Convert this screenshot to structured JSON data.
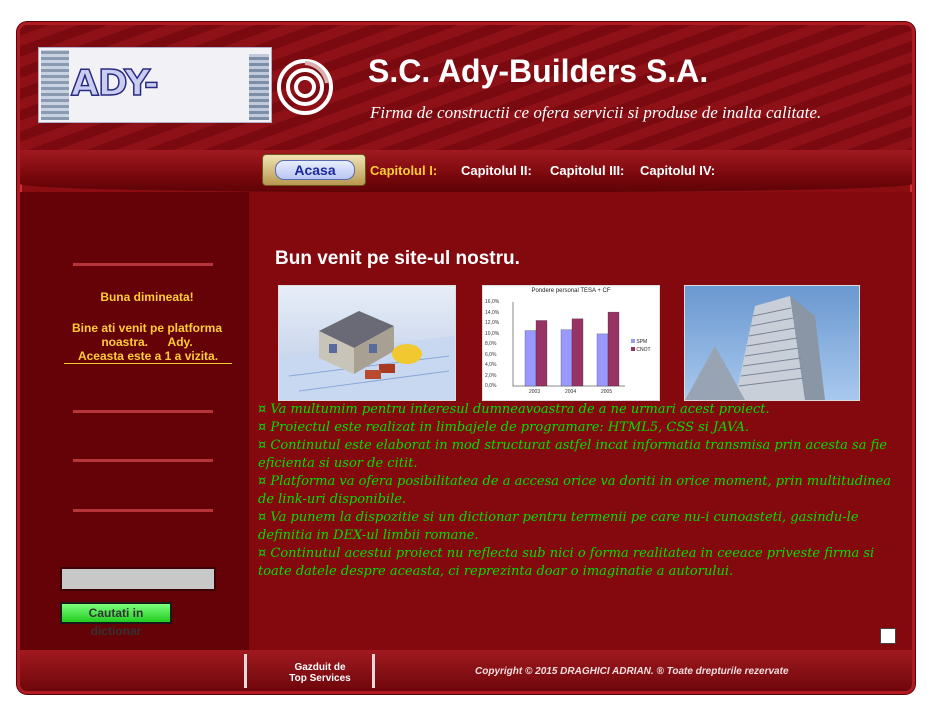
{
  "header": {
    "logo_text": "ADY-BUILDERS",
    "title": "S.C. Ady-Builders S.A.",
    "subtitle": "Firma de constructii ce ofera servicii si produse de inalta calitate."
  },
  "nav": {
    "home_label": "Acasa",
    "items": [
      "Capitolul I:",
      "Capitolul II:",
      "Capitolul III:",
      "Capitolul IV:"
    ]
  },
  "sidebar": {
    "greeting": "Buna dimineata!",
    "welcome_line1": "Bine ati venit pe platforma",
    "welcome_line2": "noastra.      Ady.",
    "visits": "Aceasta este a 1 a vizita.",
    "search_value": "",
    "search_button": "Cautati in dictionar"
  },
  "main": {
    "heading": "Bun venit pe site-ul nostru.",
    "chart_title": "Pondere personal TESA + CF",
    "chart_y_ticks": [
      "16,0%",
      "14,0%",
      "12,0%",
      "10,0%",
      "8,0%",
      "6,0%",
      "4,0%",
      "2,0%",
      "0,0%"
    ],
    "chart_x_ticks": [
      "2003",
      "2004",
      "2005"
    ],
    "chart_legend": [
      "SPM",
      "CNOT"
    ],
    "bullets": [
      "¤ Va multumim pentru interesul dumneavoastra de a ne urmari acest proiect.",
      "¤ Proiectul este realizat in limbajele de programare: HTML5, CSS si JAVA.",
      "¤ Continutul este elaborat in mod structurat astfel incat informatia transmisa prin acesta sa fie eficienta si usor de citit.",
      "¤ Platforma va ofera posibilitatea de a accesa orice va doriti in orice moment, prin multitudinea de link-uri disponibile.",
      "¤ Va punem la dispozitie si un dictionar pentru termenii pe care nu-i cunoasteti, gasindu-le definitia in DEX-ul limbii romane.",
      "¤ Continutul acestui proiect nu reflecta sub nici o forma realitatea in ceeace priveste firma si toate datele despre aceasta, ci reprezinta doar o imaginatie a autorului."
    ]
  },
  "footer": {
    "hosted_line1": "Gazduit de",
    "hosted_line2": "Top Services",
    "copyright": "Copyright © 2015 DRAGHICI ADRIAN. ® Toate drepturile rezervate"
  },
  "colors": {
    "background": "#8b0d12",
    "accent_yellow": "#ffcc33",
    "bullet_green": "#00e000"
  }
}
